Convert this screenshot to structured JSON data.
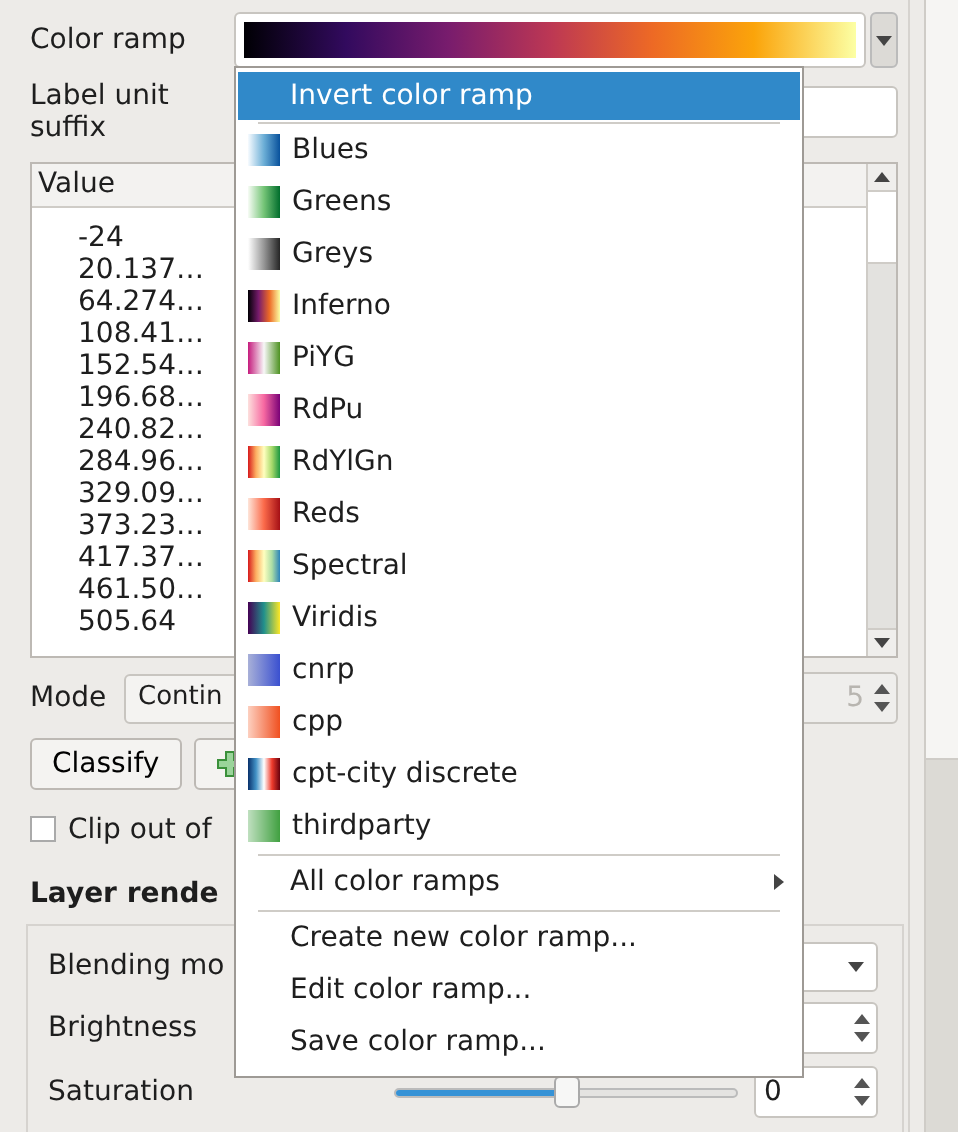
{
  "color_ramp": {
    "label": "Color ramp"
  },
  "label_unit_suffix": {
    "label": "Label unit suffix"
  },
  "table": {
    "columns": [
      "Value"
    ],
    "rows": [
      "-24",
      "20.137…",
      "64.274…",
      "108.41…",
      "152.54…",
      "196.68…",
      "240.82…",
      "284.96…",
      "329.09…",
      "373.23…",
      "417.37…",
      "461.50…",
      "505.64"
    ]
  },
  "mode": {
    "label": "Mode",
    "value": "Contin",
    "classes": "5"
  },
  "classify_button": "Classify",
  "clip": {
    "label": "Clip out of",
    "checked": false
  },
  "layer_rendering": {
    "title": "Layer rende",
    "blending_label": "Blending mo",
    "brightness_label": "Brightness",
    "saturation_label": "Saturation",
    "saturation": {
      "level": 0.5,
      "value": "0"
    }
  },
  "menu": {
    "items": [
      {
        "kind": "action",
        "label": "Invert color ramp",
        "selected": true
      },
      {
        "kind": "separator"
      },
      {
        "kind": "ramp",
        "label": "Blues",
        "selected": false
      },
      {
        "kind": "ramp",
        "label": "Greens",
        "selected": false
      },
      {
        "kind": "ramp",
        "label": "Greys",
        "selected": false
      },
      {
        "kind": "ramp",
        "label": "Inferno",
        "selected": false
      },
      {
        "kind": "ramp",
        "label": "PiYG",
        "selected": false
      },
      {
        "kind": "ramp",
        "label": "RdPu",
        "selected": false
      },
      {
        "kind": "ramp",
        "label": "RdYlGn",
        "selected": false
      },
      {
        "kind": "ramp",
        "label": "Reds",
        "selected": false
      },
      {
        "kind": "ramp",
        "label": "Spectral",
        "selected": false
      },
      {
        "kind": "ramp",
        "label": "Viridis",
        "selected": false
      },
      {
        "kind": "ramp",
        "label": "cnrp",
        "selected": false
      },
      {
        "kind": "ramp",
        "label": "cpp",
        "selected": false
      },
      {
        "kind": "ramp",
        "label": "cpt-city discrete",
        "selected": false
      },
      {
        "kind": "ramp",
        "label": "thirdparty",
        "selected": false
      },
      {
        "kind": "separator"
      },
      {
        "kind": "submenu",
        "label": "All color ramps",
        "selected": false
      },
      {
        "kind": "separator"
      },
      {
        "kind": "action",
        "label": "Create new color ramp...",
        "selected": false
      },
      {
        "kind": "action",
        "label": "Edit color ramp...",
        "selected": false
      },
      {
        "kind": "action",
        "label": "Save color ramp...",
        "selected": false
      }
    ]
  }
}
